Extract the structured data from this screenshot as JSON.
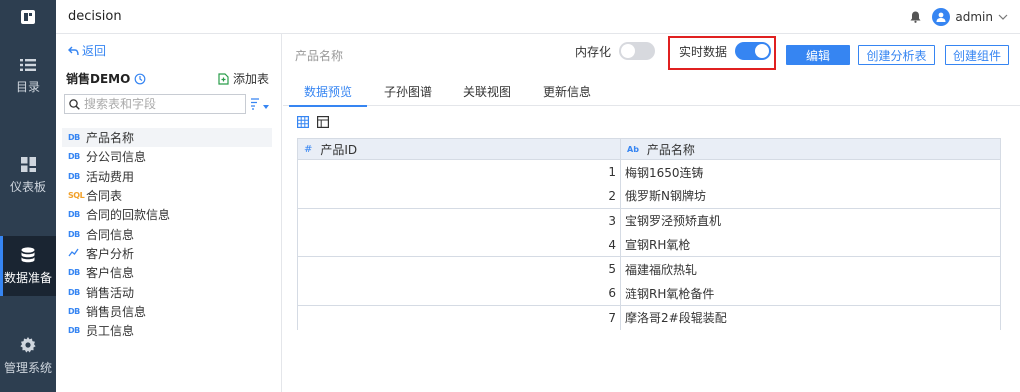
{
  "app": {
    "name": "decision",
    "user": "admin"
  },
  "nav": {
    "items": [
      {
        "label": "目录",
        "icon": "list-icon"
      },
      {
        "label": "仪表板",
        "icon": "dashboard-icon"
      },
      {
        "label": "数据准备",
        "icon": "database-icon"
      },
      {
        "label": "管理系统",
        "icon": "gear-icon"
      }
    ]
  },
  "panel": {
    "back_label": "返回",
    "package_title": "销售DEMO",
    "add_table_label": "添加表",
    "search_placeholder": "搜索表和字段",
    "tables": [
      {
        "tag": "DB",
        "label": "产品名称"
      },
      {
        "tag": "DB",
        "label": "分公司信息"
      },
      {
        "tag": "DB",
        "label": "活动费用"
      },
      {
        "tag": "SQL",
        "label": "合同表"
      },
      {
        "tag": "DB",
        "label": "合同的回款信息"
      },
      {
        "tag": "DB",
        "label": "合同信息"
      },
      {
        "tag": "~",
        "label": "客户分析"
      },
      {
        "tag": "DB",
        "label": "客户信息"
      },
      {
        "tag": "DB",
        "label": "销售活动"
      },
      {
        "tag": "DB",
        "label": "销售员信息"
      },
      {
        "tag": "DB",
        "label": "员工信息"
      }
    ]
  },
  "main": {
    "table_name": "产品名称",
    "memory_label": "内存化",
    "memory_on": false,
    "realtime_label": "实时数据",
    "realtime_on": true,
    "edit_label": "编辑",
    "create_analysis_label": "创建分析表",
    "create_component_label": "创建组件",
    "tabs": [
      "数据预览",
      "子孙图谱",
      "关联视图",
      "更新信息"
    ],
    "columns": [
      {
        "type": "#",
        "name": "产品ID"
      },
      {
        "type": "Ab",
        "name": "产品名称"
      }
    ],
    "rows": [
      {
        "id": "1",
        "name": "梅钢1650连铸"
      },
      {
        "id": "2",
        "name": "俄罗斯N钢牌坊"
      },
      {
        "id": "3",
        "name": "宝钢罗泾预矫直机"
      },
      {
        "id": "4",
        "name": "宣钢RH氧枪"
      },
      {
        "id": "5",
        "name": "福建福欣热轧"
      },
      {
        "id": "6",
        "name": "涟钢RH氧枪备件"
      },
      {
        "id": "7",
        "name": "摩洛哥2#段辊装配"
      }
    ]
  },
  "colors": {
    "accent": "#3685f2",
    "sidebar": "#2d3e50",
    "highlight": "#e02020"
  }
}
